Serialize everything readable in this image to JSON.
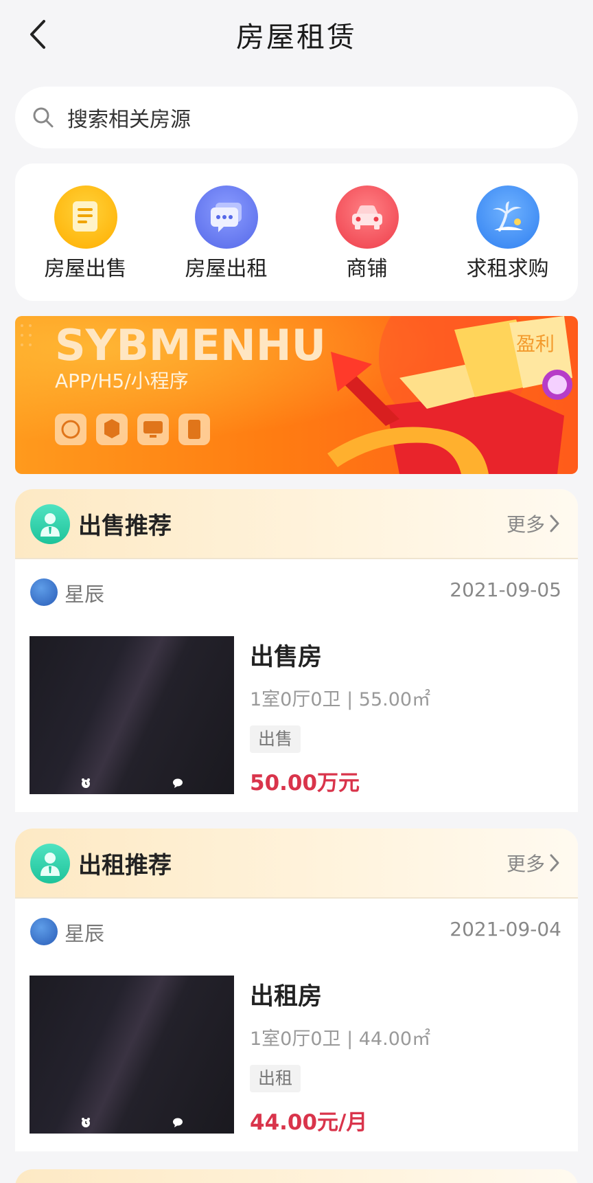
{
  "header": {
    "title": "房屋租赁"
  },
  "search": {
    "placeholder": "搜索相关房源"
  },
  "categories": [
    {
      "label": "房屋出售",
      "icon": "document-icon",
      "color": "#ffb400"
    },
    {
      "label": "房屋出租",
      "icon": "chat-icon",
      "color": "#6478f0"
    },
    {
      "label": "商铺",
      "icon": "car-icon",
      "color": "#f4525b"
    },
    {
      "label": "求租求购",
      "icon": "palm-tree-icon",
      "color": "#3d8ef2"
    }
  ],
  "banner": {
    "brand": "SYBMENHU",
    "subtitle": "APP/H5/小程序",
    "badge": "盈利"
  },
  "sections": [
    {
      "title": "出售推荐",
      "more": "更多",
      "item": {
        "user": "星辰",
        "date": "2021-09-05",
        "title": "出售房",
        "spec": "1室0厅0卫 | 55.00㎡",
        "tag": "出售",
        "price": "50.00万元"
      }
    },
    {
      "title": "出租推荐",
      "more": "更多",
      "item": {
        "user": "星辰",
        "date": "2021-09-04",
        "title": "出租房",
        "spec": "1室0厅0卫 | 44.00㎡",
        "tag": "出租",
        "price": "44.00元/月"
      }
    }
  ],
  "colors": {
    "price": "#d9344b",
    "accent_orange": "#ff7d12",
    "section_icon": "#1ec39a"
  }
}
